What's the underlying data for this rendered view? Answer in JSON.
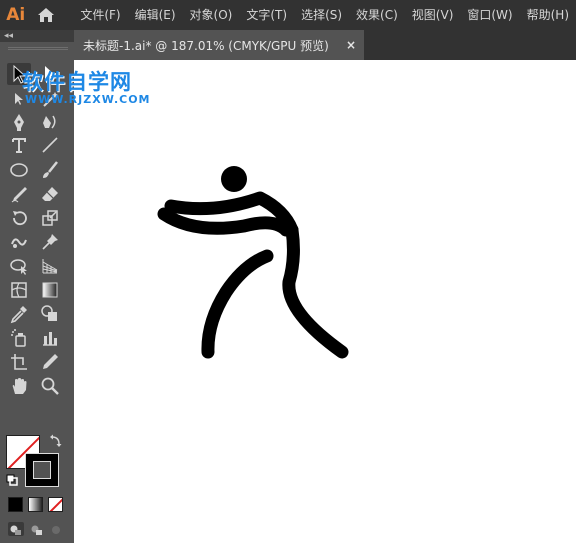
{
  "app": {
    "logo_text": "Ai",
    "logo_color": "#e8873a"
  },
  "menu": {
    "items": [
      "文件(F)",
      "编辑(E)",
      "对象(O)",
      "文字(T)",
      "选择(S)",
      "效果(C)",
      "视图(V)",
      "窗口(W)",
      "帮助(H)"
    ]
  },
  "document": {
    "tab_title": "未标题-1.ai* @ 187.01% (CMYK/GPU 预览)",
    "close_label": "×"
  },
  "toolbar": {
    "collapse_label": "◂◂",
    "icons": [
      "selection-tool-icon",
      "direct-selection-tool-icon",
      "pen-tool-icon",
      "curvature-tool-icon",
      "type-tool-icon",
      "line-segment-tool-icon",
      "ellipse-tool-icon",
      "paintbrush-tool-icon",
      "shaper-tool-icon",
      "eraser-tool-icon",
      "rotate-tool-icon",
      "scale-tool-icon",
      "warp-tool-icon",
      "puppet-warp-tool-icon",
      "free-transform-tool-icon",
      "perspective-grid-tool-icon",
      "mesh-tool-icon",
      "gradient-tool-icon",
      "eyedropper-tool-icon",
      "shape-builder-tool-icon",
      "symbol-sprayer-tool-icon",
      "column-graph-tool-icon",
      "artboard-tool-icon",
      "slice-tool-icon",
      "hand-tool-icon",
      "zoom-tool-icon"
    ]
  },
  "colors": {
    "fill": "none (white with red slash)",
    "stroke": "#000000",
    "accent": "#e8873a",
    "watermark": "#1e88e5"
  },
  "watermark": {
    "title": "软件自学网",
    "url": "WWW.RJZXW.COM"
  }
}
